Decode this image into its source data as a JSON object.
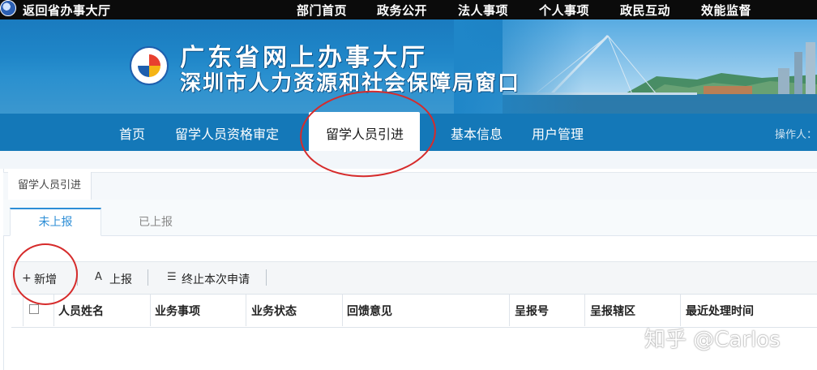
{
  "topbar": {
    "back_label": "返回省办事大厅",
    "menu": [
      "部门首页",
      "政务公开",
      "法人事项",
      "个人事项",
      "政民互动",
      "效能监督"
    ]
  },
  "banner": {
    "title_line1": "广东省网上办事大厅",
    "title_line2": "深圳市人力资源和社会保障局窗口"
  },
  "nav": {
    "items": [
      "首页",
      "留学人员资格审定",
      "留学人员引进",
      "基本信息",
      "用户管理"
    ],
    "active_index": 2,
    "operator_label": "操作人："
  },
  "breadcrumb": "留学人员引进",
  "tabs": [
    "未上报",
    "已上报"
  ],
  "toolbar": {
    "add_label": "新增",
    "submit_label": "上报",
    "terminate_label": "终止本次申请"
  },
  "table": {
    "columns": [
      "人员姓名",
      "业务事项",
      "业务状态",
      "回馈意见",
      "呈报号",
      "呈报辖区",
      "最近处理时间"
    ]
  },
  "watermark": "知乎 @Carlos",
  "colors": {
    "nav_blue": "#1478b8",
    "tab_active": "#2d8ed6",
    "annotation_red": "#d62b2b"
  }
}
